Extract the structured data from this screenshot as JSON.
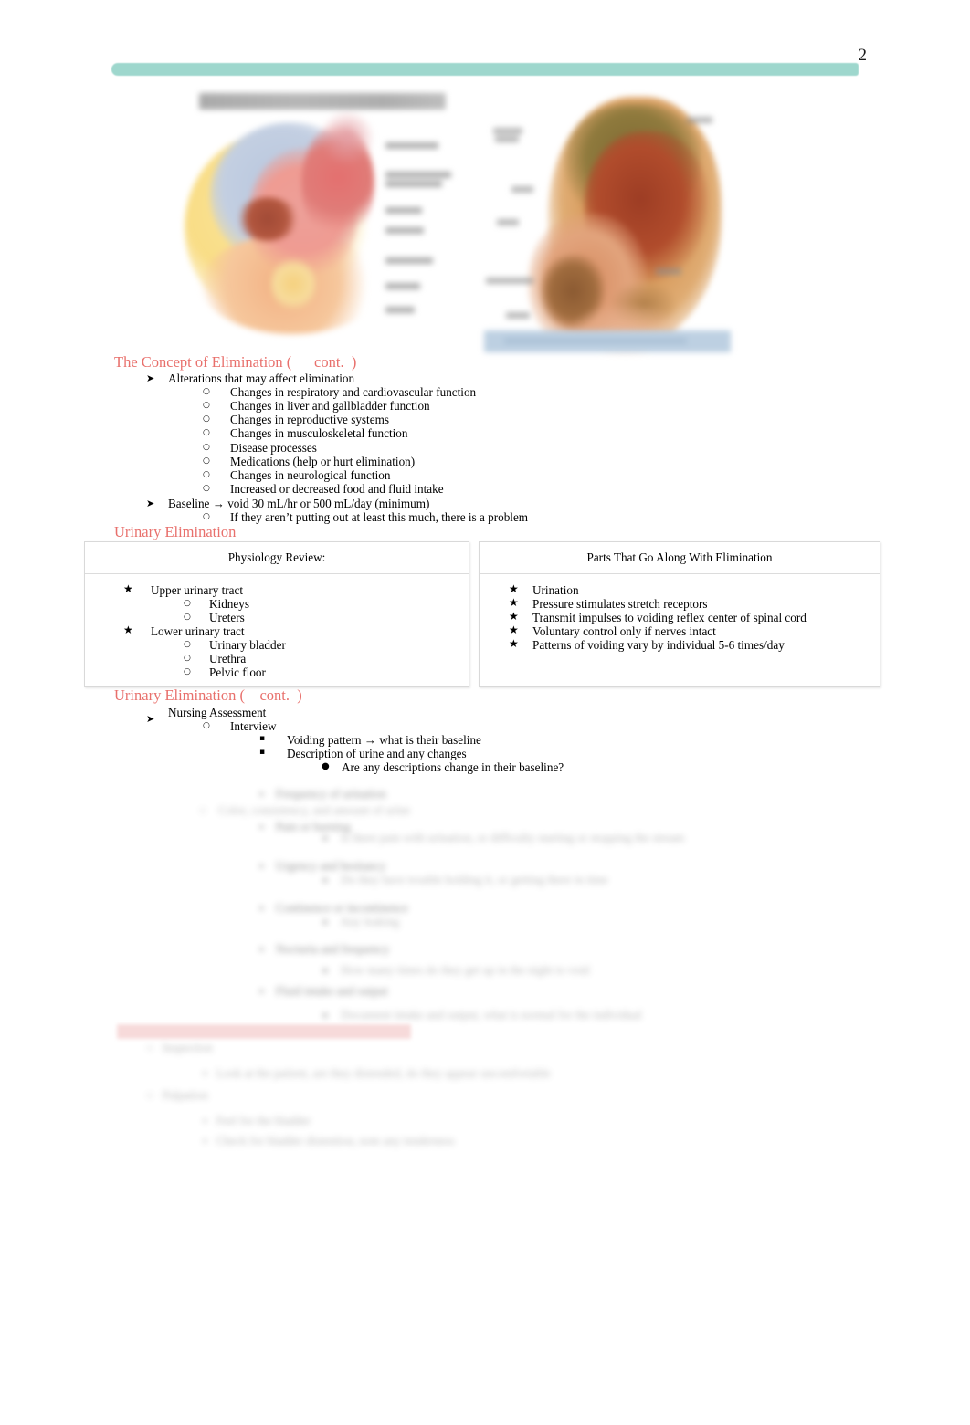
{
  "document": {
    "page_number": "2",
    "accent_teal": "#9ed7cd",
    "accent_red": "#e8706c",
    "caption_blue": "#bdd0e2"
  },
  "figures": {
    "left": {
      "name": "female-reproductive-system-diagram",
      "title_text": "",
      "labels_count": 8
    },
    "right": {
      "name": "pelvic-anatomy-diagram",
      "caption_text": "",
      "labels_count": 8
    }
  },
  "sections": [
    {
      "heading": "The Concept of Elimination (      cont.  )",
      "items": [
        {
          "level": 1,
          "bullet": "arrow",
          "text": "Alterations that may affect elimination"
        },
        {
          "level": 2,
          "bullet": "circle",
          "text": "Changes in respiratory and cardiovascular function"
        },
        {
          "level": 2,
          "bullet": "circle",
          "text": "Changes in liver and gallbladder function"
        },
        {
          "level": 2,
          "bullet": "circle",
          "text": "Changes in reproductive systems"
        },
        {
          "level": 2,
          "bullet": "circle",
          "text": "Changes in musculoskeletal function"
        },
        {
          "level": 2,
          "bullet": "circle",
          "text": "Disease processes"
        },
        {
          "level": 2,
          "bullet": "circle",
          "text": "Medications (help or hurt elimination)"
        },
        {
          "level": 2,
          "bullet": "circle",
          "text": "Changes in neurological function"
        },
        {
          "level": 2,
          "bullet": "circle",
          "text": "Increased or decreased food and fluid intake"
        },
        {
          "level": 1,
          "bullet": "arrow",
          "text": "Baseline → void 30 mL/hr or 500 mL/day (minimum)"
        },
        {
          "level": 2,
          "bullet": "circle",
          "text": "If they aren’t putting out at least this much, there is a problem"
        }
      ]
    },
    {
      "heading": "Urinary Elimination"
    },
    {
      "heading": "Urinary Elimination (    cont.  )",
      "items": [
        {
          "level": 1,
          "bullet": "arrow",
          "text": "Nursing Assessment"
        },
        {
          "level": 2,
          "bullet": "circle",
          "text": "Interview"
        },
        {
          "level": 3,
          "bullet": "square",
          "text": "Voiding pattern → what is their baseline"
        },
        {
          "level": 3,
          "bullet": "square",
          "text": "Description of urine and any changes"
        },
        {
          "level": 4,
          "bullet": "disc",
          "text": "Are any descriptions change in their baseline?"
        }
      ]
    }
  ],
  "table": {
    "columns": [
      {
        "header": "Physiology Review:",
        "items": [
          {
            "level": 1,
            "bullet": "star",
            "text": "Upper urinary tract"
          },
          {
            "level": 2,
            "bullet": "circle",
            "text": "Kidneys"
          },
          {
            "level": 2,
            "bullet": "circle",
            "text": "Ureters"
          },
          {
            "level": 1,
            "bullet": "star",
            "text": "Lower urinary tract"
          },
          {
            "level": 2,
            "bullet": "circle",
            "text": "Urinary bladder"
          },
          {
            "level": 2,
            "bullet": "circle",
            "text": "Urethra"
          },
          {
            "level": 2,
            "bullet": "circle",
            "text": "Pelvic floor"
          }
        ]
      },
      {
        "header": "Parts That Go Along With Elimination",
        "items": [
          {
            "level": 1,
            "bullet": "star",
            "text": "Urination"
          },
          {
            "level": 1,
            "bullet": "star",
            "text": "Pressure stimulates stretch receptors"
          },
          {
            "level": 1,
            "bullet": "star",
            "text": "Transmit impulses to voiding reflex center of spinal cord"
          },
          {
            "level": 1,
            "bullet": "star",
            "text": "Voluntary control only if nerves intact"
          },
          {
            "level": 1,
            "bullet": "star",
            "text": "Patterns of voiding vary by individual 5-6 times/day"
          }
        ]
      }
    ]
  },
  "obscured": {
    "note": "",
    "lines": [
      "▪    Frequency of urination",
      "○    Color, consistency, and amount of urine",
      "▪    Pain or burning",
      "●    Is there pain with urination, or difficulty starting or stopping the stream",
      "▪    Urgency and hesitancy",
      "●    Do they have trouble holding it, or getting there in time",
      "▪    Continence or incontinence",
      "●    Any leaking",
      "▪    Nocturia and frequency",
      "●    How many times do they get up in the night to void",
      "▪    Fluid intake and output",
      "●    Document intake and output, what is normal for the individual"
    ],
    "lines_lower": [
      "○   Inspection",
      "▪   Look at the patient, are they distended, do they appear uncomfortable",
      "○   Palpation",
      "▪   Feel for the bladder",
      "▪   Check for bladder distention, note any tenderness"
    ]
  }
}
